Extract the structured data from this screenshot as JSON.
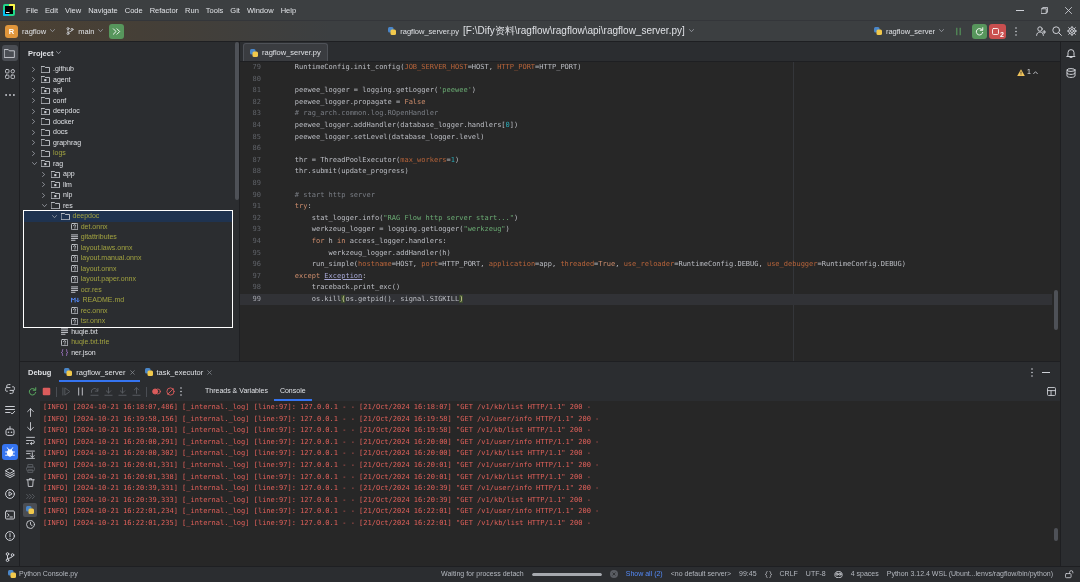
{
  "title_bar": {
    "menu": [
      "File",
      "Edit",
      "View",
      "Navigate",
      "Code",
      "Refactor",
      "Run",
      "Tools",
      "Git",
      "Window",
      "Help"
    ]
  },
  "toolbar": {
    "project_badge": "R",
    "project": "ragflow",
    "branch": "main",
    "file": "ragflow_server.py",
    "path": "[F:\\Dify资料\\ragflow\\ragflow\\api\\ragflow_server.py]",
    "run_config": "ragflow_server",
    "process_count": "2"
  },
  "tool_stripe": {
    "top": [
      {
        "selected": true,
        "focused": false
      },
      {
        "selected": false,
        "focused": false
      }
    ],
    "bottom": [
      {
        "selected": false,
        "focused": false
      },
      {
        "selected": false,
        "focused": false
      },
      {
        "selected": false,
        "focused": false
      },
      {
        "selected": true,
        "focused": true
      },
      {
        "selected": false,
        "focused": false
      },
      {
        "selected": false,
        "focused": false
      },
      {
        "selected": false,
        "focused": false
      },
      {
        "selected": false,
        "focused": false
      },
      {
        "selected": false,
        "focused": false
      }
    ]
  },
  "project": {
    "title": "Project",
    "tree": [
      {
        "name": ".github",
        "kind": "folder",
        "expanded": false,
        "selected": false,
        "ignored": false,
        "framed": false
      },
      {
        "name": "agent",
        "kind": "package",
        "expanded": false,
        "selected": false,
        "ignored": false,
        "framed": false
      },
      {
        "name": "api",
        "kind": "package",
        "expanded": false,
        "selected": false,
        "ignored": false,
        "framed": false
      },
      {
        "name": "conf",
        "kind": "folder",
        "expanded": false,
        "selected": false,
        "ignored": false,
        "framed": false
      },
      {
        "name": "deepdoc",
        "kind": "package",
        "expanded": false,
        "selected": false,
        "ignored": false,
        "framed": false
      },
      {
        "name": "docker",
        "kind": "folder",
        "expanded": false,
        "selected": false,
        "ignored": false,
        "framed": false
      },
      {
        "name": "docs",
        "kind": "folder",
        "expanded": false,
        "selected": false,
        "ignored": false,
        "framed": false
      },
      {
        "name": "graphrag",
        "kind": "folder",
        "expanded": false,
        "selected": false,
        "ignored": false,
        "framed": false
      },
      {
        "name": "logs",
        "kind": "folder",
        "expanded": false,
        "selected": false,
        "ignored": true,
        "framed": false
      },
      {
        "name": "rag",
        "kind": "package",
        "expanded": true,
        "selected": false,
        "ignored": false,
        "framed": false,
        "children": [
          {
            "name": "app",
            "kind": "package",
            "expanded": false,
            "selected": false,
            "ignored": false,
            "framed": false
          },
          {
            "name": "llm",
            "kind": "package",
            "expanded": false,
            "selected": false,
            "ignored": false,
            "framed": false
          },
          {
            "name": "nlp",
            "kind": "package",
            "expanded": false,
            "selected": false,
            "ignored": false,
            "framed": false
          },
          {
            "name": "res",
            "kind": "folder",
            "expanded": true,
            "selected": false,
            "ignored": false,
            "framed": false,
            "children": [
              {
                "name": "deepdoc",
                "kind": "folder",
                "expanded": true,
                "selected": true,
                "ignored": true,
                "framed": true,
                "children": [
                  {
                    "name": "det.onnx",
                    "kind": "binary",
                    "selected": false,
                    "ignored": true,
                    "framed": false
                  },
                  {
                    "name": "gitattributes",
                    "kind": "text",
                    "selected": false,
                    "ignored": true,
                    "framed": false
                  },
                  {
                    "name": "layout.laws.onnx",
                    "kind": "binary",
                    "selected": false,
                    "ignored": true,
                    "framed": false
                  },
                  {
                    "name": "layout.manual.onnx",
                    "kind": "binary",
                    "selected": false,
                    "ignored": true,
                    "framed": false
                  },
                  {
                    "name": "layout.onnx",
                    "kind": "binary",
                    "selected": false,
                    "ignored": true,
                    "framed": false
                  },
                  {
                    "name": "layout.paper.onnx",
                    "kind": "binary",
                    "selected": false,
                    "ignored": true,
                    "framed": false
                  },
                  {
                    "name": "ocr.res",
                    "kind": "text",
                    "selected": false,
                    "ignored": true,
                    "framed": false
                  },
                  {
                    "name": "README.md",
                    "kind": "markdown",
                    "selected": false,
                    "ignored": true,
                    "framed": false
                  },
                  {
                    "name": "rec.onnx",
                    "kind": "binary",
                    "selected": false,
                    "ignored": true,
                    "framed": false
                  },
                  {
                    "name": "tsr.onnx",
                    "kind": "binary",
                    "selected": false,
                    "ignored": true,
                    "framed": false
                  }
                ]
              },
              {
                "name": "huqie.txt",
                "kind": "text",
                "selected": false,
                "ignored": false,
                "framed": false
              },
              {
                "name": "huqie.txt.trie",
                "kind": "binary",
                "selected": false,
                "ignored": true,
                "framed": false
              },
              {
                "name": "ner.json",
                "kind": "json",
                "selected": false,
                "ignored": false,
                "framed": false
              }
            ]
          }
        ]
      }
    ]
  },
  "editor": {
    "tabs": [
      {
        "label": "ragflow_server.py",
        "selected": true
      }
    ],
    "problems": "1",
    "lines": [
      {
        "number": "79",
        "current": false,
        "tokens": [
          {
            "kind": "plain",
            "text": "    RuntimeConfig.init_config("
          },
          {
            "kind": "param",
            "text": "JOB_SERVER_HOST"
          },
          {
            "kind": "plain",
            "text": "=HOST, "
          },
          {
            "kind": "param",
            "text": "HTTP_PORT"
          },
          {
            "kind": "plain",
            "text": "=HTTP_PORT)"
          }
        ]
      },
      {
        "number": "80",
        "current": false
      },
      {
        "number": "81",
        "current": false,
        "tokens": [
          {
            "kind": "plain",
            "text": "    peewee_logger = logging.getLogger("
          },
          {
            "kind": "string",
            "text": "'peewee'"
          },
          {
            "kind": "plain",
            "text": ")"
          }
        ]
      },
      {
        "number": "82",
        "current": false,
        "tokens": [
          {
            "kind": "plain",
            "text": "    peewee_logger.propagate = "
          },
          {
            "kind": "keyword",
            "text": "False"
          }
        ]
      },
      {
        "number": "83",
        "current": false,
        "tokens": [
          {
            "kind": "comment",
            "text": "    # rag_arch.common.log.ROpenHandler"
          }
        ]
      },
      {
        "number": "84",
        "current": false,
        "tokens": [
          {
            "kind": "plain",
            "text": "    peewee_logger.addHandler(database_logger.handlers["
          },
          {
            "kind": "number",
            "text": "0"
          },
          {
            "kind": "plain",
            "text": "])"
          }
        ]
      },
      {
        "number": "85",
        "current": false,
        "tokens": [
          {
            "kind": "plain",
            "text": "    peewee_logger.setLevel(database_logger.level)"
          }
        ]
      },
      {
        "number": "86",
        "current": false
      },
      {
        "number": "87",
        "current": false,
        "tokens": [
          {
            "kind": "plain",
            "text": "    thr = ThreadPoolExecutor("
          },
          {
            "kind": "param",
            "text": "max_workers"
          },
          {
            "kind": "plain",
            "text": "="
          },
          {
            "kind": "number",
            "text": "1"
          },
          {
            "kind": "plain",
            "text": ")"
          }
        ]
      },
      {
        "number": "88",
        "current": false,
        "tokens": [
          {
            "kind": "plain",
            "text": "    thr.submit(update_progress)"
          }
        ]
      },
      {
        "number": "89",
        "current": false
      },
      {
        "number": "90",
        "current": false,
        "tokens": [
          {
            "kind": "comment",
            "text": "    # start http server"
          }
        ]
      },
      {
        "number": "91",
        "current": false,
        "tokens": [
          {
            "kind": "keyword",
            "text": "    try"
          },
          {
            "kind": "plain",
            "text": ":"
          }
        ]
      },
      {
        "number": "92",
        "current": false,
        "tokens": [
          {
            "kind": "plain",
            "text": "        stat_logger.info("
          },
          {
            "kind": "string",
            "text": "\"RAG Flow http server start...\""
          },
          {
            "kind": "plain",
            "text": ")"
          }
        ]
      },
      {
        "number": "93",
        "current": false,
        "tokens": [
          {
            "kind": "plain",
            "text": "        werkzeug_logger = logging.getLogger("
          },
          {
            "kind": "string",
            "text": "\"werkzeug\""
          },
          {
            "kind": "plain",
            "text": ")"
          }
        ]
      },
      {
        "number": "94",
        "current": false,
        "tokens": [
          {
            "kind": "keyword",
            "text": "        for"
          },
          {
            "kind": "plain",
            "text": " h "
          },
          {
            "kind": "keyword",
            "text": "in"
          },
          {
            "kind": "plain",
            "text": " access_logger.handlers:"
          }
        ]
      },
      {
        "number": "95",
        "current": false,
        "tokens": [
          {
            "kind": "plain",
            "text": "            werkzeug_logger.addHandler(h)"
          }
        ]
      },
      {
        "number": "96",
        "current": false,
        "tokens": [
          {
            "kind": "plain",
            "text": "        run_simple("
          },
          {
            "kind": "param",
            "text": "hostname"
          },
          {
            "kind": "plain",
            "text": "=HOST, "
          },
          {
            "kind": "param",
            "text": "port"
          },
          {
            "kind": "plain",
            "text": "=HTTP_PORT, "
          },
          {
            "kind": "param",
            "text": "application"
          },
          {
            "kind": "plain",
            "text": "=app, "
          },
          {
            "kind": "param",
            "text": "threaded"
          },
          {
            "kind": "plain",
            "text": "="
          },
          {
            "kind": "keyword",
            "text": "True"
          },
          {
            "kind": "plain",
            "text": ", "
          },
          {
            "kind": "param",
            "text": "use_reloader"
          },
          {
            "kind": "plain",
            "text": "=RuntimeConfig.DEBUG, "
          },
          {
            "kind": "param",
            "text": "use_debugger"
          },
          {
            "kind": "plain",
            "text": "=RuntimeConfig.DEBUG)"
          }
        ]
      },
      {
        "number": "97",
        "current": false,
        "tokens": [
          {
            "kind": "keyword",
            "text": "    except "
          },
          {
            "kind": "builtin",
            "text": "Exception"
          },
          {
            "kind": "plain",
            "text": ":"
          }
        ]
      },
      {
        "number": "98",
        "current": false,
        "tokens": [
          {
            "kind": "plain",
            "text": "        traceback.print_exc()"
          }
        ]
      },
      {
        "number": "99",
        "current": true,
        "tokens": [
          {
            "kind": "plain",
            "text": "        os.kill"
          },
          {
            "kind": "bracket_match",
            "text": "("
          },
          {
            "kind": "plain",
            "text": "os.getpid(), signal.SIGKILL"
          },
          {
            "kind": "bracket_match",
            "text": ")"
          }
        ]
      }
    ]
  },
  "debug": {
    "title": "Debug",
    "sessions": [
      {
        "label": "ragflow_server",
        "selected": true
      },
      {
        "label": "task_executor",
        "selected": false
      }
    ],
    "toolbar": [
      {
        "disabled": false
      },
      {
        "disabled": false
      },
      {
        "disabled": true
      },
      {
        "disabled": false
      },
      {
        "disabled": true
      },
      {
        "disabled": true
      },
      {
        "disabled": true
      },
      {
        "disabled": true
      },
      {
        "disabled": false
      },
      {
        "disabled": false
      },
      {
        "disabled": false
      }
    ],
    "tabs": [
      {
        "label": "Threads & Variables",
        "selected": false
      },
      {
        "label": "Console",
        "selected": true
      }
    ],
    "side_toolbar": [
      {
        "disabled": false,
        "selected": false
      },
      {
        "disabled": false,
        "selected": false
      },
      {
        "disabled": false,
        "selected": false
      },
      {
        "disabled": false,
        "selected": false
      },
      {
        "disabled": true,
        "selected": false
      },
      {
        "disabled": false,
        "selected": false
      },
      {
        "disabled": true,
        "selected": false
      },
      {
        "disabled": false,
        "selected": true
      },
      {
        "disabled": false,
        "selected": false
      }
    ],
    "console": [
      {
        "error": true,
        "text": "[INFO] [2024-10-21 16:18:07,486] [_internal._log] [line:97]: 127.0.0.1 - - [21/Oct/2024 16:18:07] \"GET /v1/kb/list HTTP/1.1\" 200 -"
      },
      {
        "error": true,
        "text": "[INFO] [2024-10-21 16:19:58,156] [_internal._log] [line:97]: 127.0.0.1 - - [21/Oct/2024 16:19:58] \"GET /v1/user/info HTTP/1.1\" 200 -"
      },
      {
        "error": true,
        "text": "[INFO] [2024-10-21 16:19:58,191] [_internal._log] [line:97]: 127.0.0.1 - - [21/Oct/2024 16:19:58] \"GET /v1/kb/list HTTP/1.1\" 200 -"
      },
      {
        "error": true,
        "text": "[INFO] [2024-10-21 16:20:00,291] [_internal._log] [line:97]: 127.0.0.1 - - [21/Oct/2024 16:20:00] \"GET /v1/user/info HTTP/1.1\" 200 -"
      },
      {
        "error": true,
        "text": "[INFO] [2024-10-21 16:20:00,302] [_internal._log] [line:97]: 127.0.0.1 - - [21/Oct/2024 16:20:00] \"GET /v1/kb/list HTTP/1.1\" 200 -"
      },
      {
        "error": true,
        "text": "[INFO] [2024-10-21 16:20:01,331] [_internal._log] [line:97]: 127.0.0.1 - - [21/Oct/2024 16:20:01] \"GET /v1/user/info HTTP/1.1\" 200 -"
      },
      {
        "error": true,
        "text": "[INFO] [2024-10-21 16:20:01,338] [_internal._log] [line:97]: 127.0.0.1 - - [21/Oct/2024 16:20:01] \"GET /v1/kb/list HTTP/1.1\" 200 -"
      },
      {
        "error": true,
        "text": "[INFO] [2024-10-21 16:20:39,331] [_internal._log] [line:97]: 127.0.0.1 - - [21/Oct/2024 16:20:39] \"GET /v1/user/info HTTP/1.1\" 200 -"
      },
      {
        "error": true,
        "text": "[INFO] [2024-10-21 16:20:39,333] [_internal._log] [line:97]: 127.0.0.1 - - [21/Oct/2024 16:20:39] \"GET /v1/kb/list HTTP/1.1\" 200 -"
      },
      {
        "error": true,
        "text": "[INFO] [2024-10-21 16:22:01,234] [_internal._log] [line:97]: 127.0.0.1 - - [21/Oct/2024 16:22:01] \"GET /v1/user/info HTTP/1.1\" 200 -"
      },
      {
        "error": true,
        "text": "[INFO] [2024-10-21 16:22:01,235] [_internal._log] [line:97]: 127.0.0.1 - - [21/Oct/2024 16:22:01] \"GET /v1/kb/list HTTP/1.1\" 200 -"
      }
    ]
  },
  "status_bar": {
    "breadcrumb": "Python Console.py",
    "task": "Waiting for process detach",
    "progress": {
      "level": 1
    },
    "show_all": "Show all (2)",
    "server": "<no default server>",
    "position": "99:45",
    "line_separator": "CRLF",
    "encoding": "UTF-8",
    "indent": "4 spaces",
    "interpreter": "Python 3.12.4 WSL (Ubunt...lenvs/ragflow/bin/python)"
  }
}
